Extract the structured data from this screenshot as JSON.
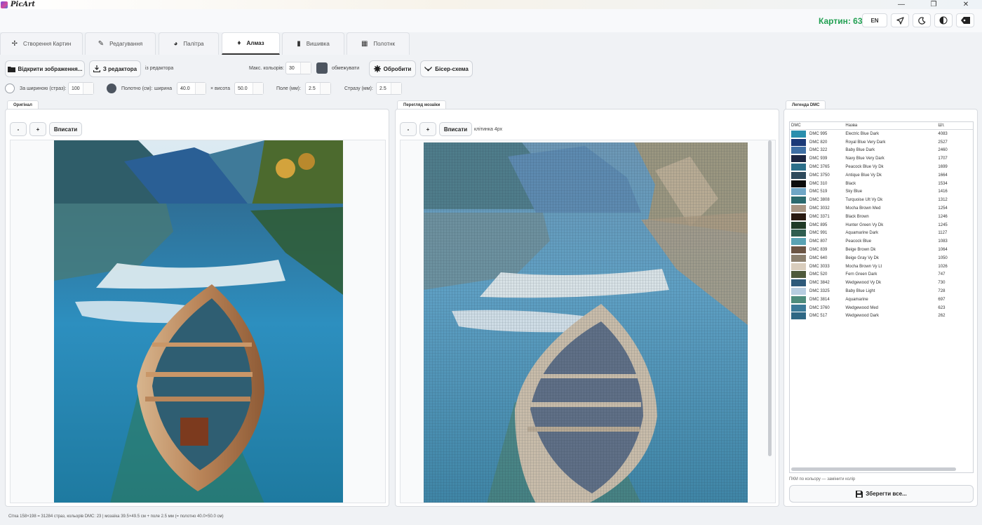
{
  "app": {
    "title": "PicArt"
  },
  "window_controls": {
    "minimize": "—",
    "restore": "❐",
    "close": "✕"
  },
  "header": {
    "count_label": "Картин: 63",
    "lang_button": "EN",
    "icons": [
      "send-icon",
      "moon-icon",
      "contrast-icon",
      "tag-back-icon"
    ]
  },
  "tabs": [
    {
      "label": "Створення Картин",
      "icon": "sparkle-icon",
      "glyph": "✢"
    },
    {
      "label": "Редагування",
      "icon": "brush-icon",
      "glyph": "✎"
    },
    {
      "label": "Палітра",
      "icon": "palette-icon",
      "glyph": "◕"
    },
    {
      "label": "Алмаз",
      "icon": "diamond-icon",
      "glyph": "♦"
    },
    {
      "label": "Вишивка",
      "icon": "spool-icon",
      "glyph": "▮"
    },
    {
      "label": "Полотнк",
      "icon": "grid-icon",
      "glyph": "▦"
    }
  ],
  "toolbar1": {
    "open_button": "Відкрити зображення...",
    "from_editor_button": "З редактора",
    "from_editor_label": "із редактора",
    "max_colors_label": "Макс. кольорів:",
    "max_colors_value": "30",
    "limit_label": "обмежувати",
    "process_button": "Обробити",
    "bead_button": "Бісер-схема"
  },
  "toolbar2": {
    "by_width_label": "За шириною (страз):",
    "by_width_value": "100",
    "canvas_label": "Полотно (см):",
    "width_label": "ширина",
    "width_value": "40.0",
    "height_label": "× висота",
    "height_value": "50.0",
    "margin_label": "Поле (мм):",
    "margin_value": "2.5",
    "strass_label": "Стразу (мм):",
    "strass_value": "2.5"
  },
  "original_panel": {
    "tab": "Оригінал",
    "zoom_out": "-",
    "zoom_in": "+",
    "fit": "Вписати"
  },
  "mosaic_panel": {
    "tab": "Перегляд мозаїки",
    "zoom_out": "-",
    "zoom_in": "+",
    "fit": "Вписати",
    "cell_label": "клітинка 4px"
  },
  "legend_panel": {
    "tab": "Легенда DMC",
    "columns": [
      "DMC",
      "Назва",
      "Шт."
    ],
    "rows": [
      {
        "code": "DMC 995",
        "name": "Electric Blue Dark",
        "count": "4083",
        "color": "#2a8fae"
      },
      {
        "code": "DMC 820",
        "name": "Royal Blue Very Dark",
        "count": "2527",
        "color": "#1b3a78"
      },
      {
        "code": "DMC 322",
        "name": "Baby Blue Dark",
        "count": "2460",
        "color": "#3f6fa4"
      },
      {
        "code": "DMC 939",
        "name": "Navy Blue Very Dark",
        "count": "1707",
        "color": "#1c2540"
      },
      {
        "code": "DMC 3765",
        "name": "Peacock Blue Vy Dk",
        "count": "1699",
        "color": "#2c6f8a"
      },
      {
        "code": "DMC 3750",
        "name": "Antique Blue Vy Dk",
        "count": "1664",
        "color": "#2e4a5c"
      },
      {
        "code": "DMC 310",
        "name": "Black",
        "count": "1534",
        "color": "#0c0c0c"
      },
      {
        "code": "DMC 519",
        "name": "Sky Blue",
        "count": "1416",
        "color": "#6fa6c6"
      },
      {
        "code": "DMC 3808",
        "name": "Turquoise Ult Vy Dk",
        "count": "1312",
        "color": "#2c6a6e"
      },
      {
        "code": "DMC 3032",
        "name": "Mocha Brown Med",
        "count": "1254",
        "color": "#a99683"
      },
      {
        "code": "DMC 3371",
        "name": "Black Brown",
        "count": "1246",
        "color": "#2a1b12"
      },
      {
        "code": "DMC 895",
        "name": "Hunter Green Vy Dk",
        "count": "1245",
        "color": "#203a26"
      },
      {
        "code": "DMC 991",
        "name": "Aquamarine Dark",
        "count": "1127",
        "color": "#2f5e50"
      },
      {
        "code": "DMC 807",
        "name": "Peacock Blue",
        "count": "1083",
        "color": "#5aa3b4"
      },
      {
        "code": "DMC 839",
        "name": "Beige Brown Dk",
        "count": "1064",
        "color": "#6b5544"
      },
      {
        "code": "DMC 640",
        "name": "Beige Gray Vy Dk",
        "count": "1050",
        "color": "#8b806e"
      },
      {
        "code": "DMC 3033",
        "name": "Mocha Brown Vy Lt",
        "count": "1026",
        "color": "#d9cdbd"
      },
      {
        "code": "DMC 520",
        "name": "Fern Green Dark",
        "count": "747",
        "color": "#4f5a3c"
      },
      {
        "code": "DMC 3842",
        "name": "Wedgewood Vy Dk",
        "count": "730",
        "color": "#2e5a7a"
      },
      {
        "code": "DMC 3325",
        "name": "Baby Blue Light",
        "count": "728",
        "color": "#b7cde0"
      },
      {
        "code": "DMC 3814",
        "name": "Aquamarine",
        "count": "697",
        "color": "#4e8c7c"
      },
      {
        "code": "DMC 3760",
        "name": "Wedgewood Med",
        "count": "623",
        "color": "#3b7a98"
      },
      {
        "code": "DMC 517",
        "name": "Wedgewood Dark",
        "count": "262",
        "color": "#2f6784"
      }
    ],
    "hint": "ПКМ по кольору — замінити колір",
    "save_button": "Зберегти все..."
  },
  "status_bar": "Сітка 158×198 = 31284 страз, кольорів DMC: 23 | мозаїка 39.5×49.5 см + поле 2.5 мм (= полотно 40.0×50.0 см)"
}
